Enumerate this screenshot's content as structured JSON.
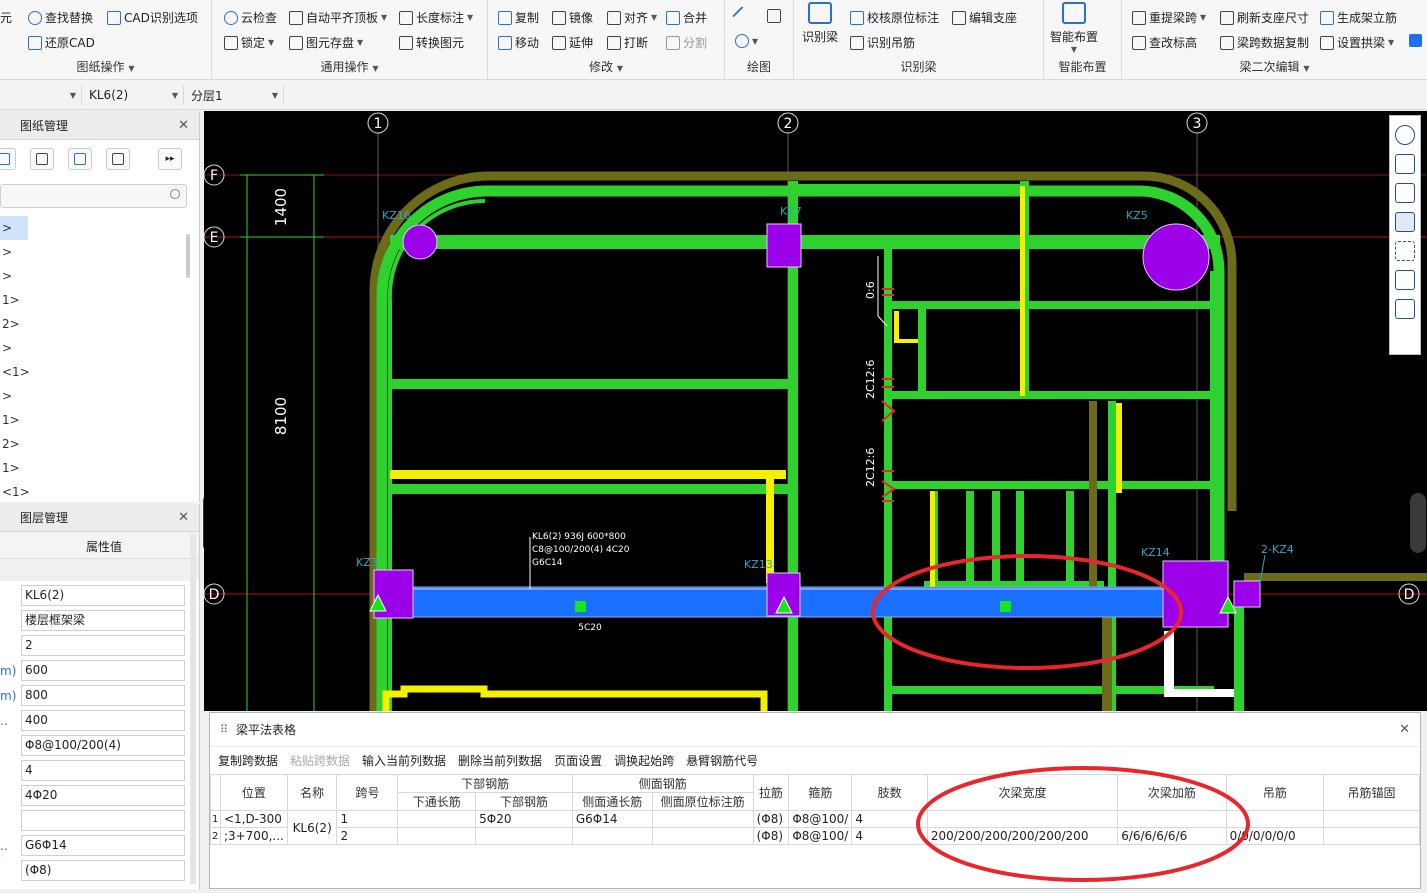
{
  "ribbon": {
    "group_drawing_ops": {
      "label": "图纸操作",
      "items": [
        "元",
        "查找替换",
        "CAD识别选项",
        "还原CAD"
      ]
    },
    "group_general_ops": {
      "label": "通用操作",
      "items": [
        "云检查",
        "自动平齐顶板",
        "长度标注",
        "锁定",
        "图元存盘",
        "转换图元"
      ]
    },
    "group_modify": {
      "label": "修改",
      "items": [
        "复制",
        "镜像",
        "对齐",
        "合并",
        "移动",
        "延伸",
        "打断",
        "分割"
      ]
    },
    "group_draw": {
      "label": "绘图"
    },
    "group_identify_beam": {
      "label": "识别梁",
      "items": [
        "识别梁",
        "校核原位标注",
        "编辑支座",
        "识别吊筋"
      ]
    },
    "group_smart": {
      "label": "智能布置",
      "items": [
        "智能布置"
      ]
    },
    "group_beam_edit": {
      "label": "梁二次编辑",
      "items": [
        "重提梁跨",
        "刷新支座尺寸",
        "生成架立筋",
        "查改标高",
        "梁跨数据复制",
        "设置拱梁"
      ]
    }
  },
  "selectors": {
    "element_name": "KL6(2)",
    "layer": "分层1"
  },
  "drawing_panel": {
    "title": "图纸管理",
    "tree": [
      ">",
      ">",
      ">",
      "1>",
      "2>",
      ">",
      "<1>",
      ">",
      "1>",
      "2>",
      "1>",
      "<1>"
    ]
  },
  "layer_panel": {
    "title": "图层管理",
    "header_value": "属性值",
    "rows": [
      {
        "label": "",
        "value": "KL6(2)"
      },
      {
        "label": "",
        "value": "楼层框架梁"
      },
      {
        "label": "",
        "value": "2"
      },
      {
        "label": "m)",
        "value": "600"
      },
      {
        "label": "m)",
        "value": "800"
      },
      {
        "label": "..",
        "value": "400"
      },
      {
        "label": "",
        "value": "Φ8@100/200(4)"
      },
      {
        "label": "",
        "value": "4"
      },
      {
        "label": "",
        "value": "4Φ20"
      },
      {
        "label": "",
        "value": ""
      },
      {
        "label": "..",
        "value": "G6Φ14"
      },
      {
        "label": "",
        "value": "(Φ8)"
      }
    ]
  },
  "canvas": {
    "axes_top": [
      "1",
      "2",
      "3"
    ],
    "axes_left": [
      "F",
      "E",
      "D"
    ],
    "axis_right": "D",
    "dims": [
      "1400",
      "8100"
    ],
    "columns": [
      "KZ16",
      "KZ7",
      "KZ5",
      "KZ3",
      "KZ13",
      "KZ14",
      "2-KZ4"
    ],
    "beam_annotation": [
      "KL6(2) 936J 600*800",
      "C8@100/200(4) 4C20",
      "G6C14"
    ],
    "beam_bottom_label": "5C20",
    "vertical_labels": [
      "0:6",
      "2C12:6",
      "2C12:6"
    ]
  },
  "table_panel": {
    "title": "梁平法表格",
    "tools": [
      "复制跨数据",
      "粘贴跨数据",
      "输入当前列数据",
      "删除当前列数据",
      "页面设置",
      "调换起始跨",
      "悬臂钢筋代号"
    ],
    "group_headers": {
      "bottom_rebar": "下部钢筋",
      "side_rebar": "侧面钢筋"
    },
    "columns": [
      "位置",
      "名称",
      "跨号",
      "下通长筋",
      "下部钢筋",
      "侧面通长筋",
      "侧面原位标注筋",
      "拉筋",
      "箍筋",
      "肢数",
      "次梁宽度",
      "次梁加筋",
      "吊筋",
      "吊筋锚固"
    ],
    "rows": [
      [
        "1",
        "<1,D-300",
        "KL6(2)",
        "1",
        "",
        "5Φ20",
        "G6Φ14",
        "",
        "(Φ8)",
        "Φ8@100/",
        "4",
        "",
        "",
        "",
        ""
      ],
      [
        "2",
        ";3+700,...",
        "",
        "2",
        "",
        "",
        "",
        "",
        "(Φ8)",
        "Φ8@100/",
        "4",
        "200/200/200/200/200/200",
        "6/6/6/6/6/6",
        "0/0/0/0/0/0",
        ""
      ]
    ]
  },
  "colors": {
    "beam_green": "#2ed12e",
    "selected_beam": "#1a6fff",
    "column_purple": "#9b00e8",
    "highlight_red": "#e8262b",
    "yellow_line": "#f4f000"
  }
}
